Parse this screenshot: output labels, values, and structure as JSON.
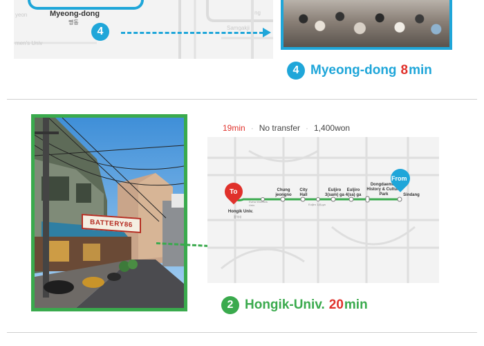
{
  "top_section": {
    "station_name": "Myeong-dong",
    "station_sub": "명동",
    "line_number": "4",
    "ghost_labels": [
      "yeon",
      "men's Univ",
      "Samgakji",
      "ng"
    ],
    "title_number": "4",
    "title_station": "Myeong-dong",
    "title_minutes": "8",
    "title_unit": "min"
  },
  "middle_section": {
    "line_number": "2",
    "sign_text": "BATTERY86",
    "card": {
      "duration": "19min",
      "transfer": "No transfer",
      "fare": "1,400won",
      "pin_to": "To",
      "pin_from": "From",
      "stations": [
        {
          "name": "Hongik Univ.",
          "sub": "홍익대"
        },
        {
          "name": "Ewha Womans Univ."
        },
        {
          "name": "Chung jeongno"
        },
        {
          "name": "City Hall"
        },
        {
          "name": "Euljiro 1(il)-ga"
        },
        {
          "name": "Euljiro 3(sam) ga"
        },
        {
          "name": "Euljiro 4(sa) ga"
        },
        {
          "name": "Dongdaemun History & Culture Park"
        },
        {
          "name": "Sindang"
        }
      ]
    },
    "title_number": "2",
    "title_station": "Hongik-Univ.",
    "title_minutes": "20",
    "title_unit": "min"
  },
  "colors": {
    "line4_blue": "#1fa6d9",
    "line2_green": "#3aaa4d",
    "accent_red": "#e0312b"
  }
}
